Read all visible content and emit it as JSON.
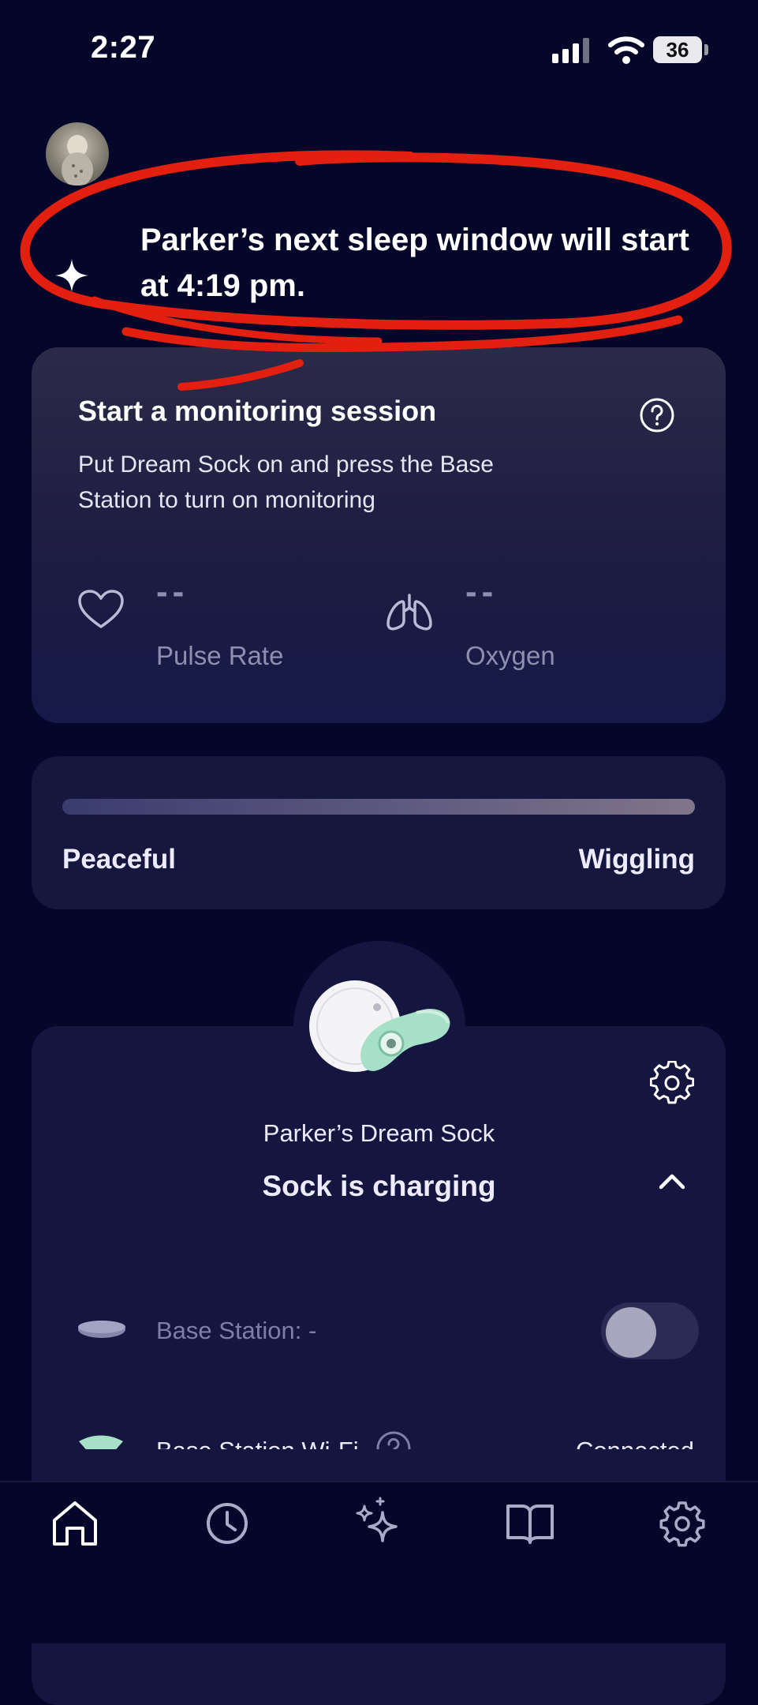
{
  "status_bar": {
    "time": "2:27",
    "battery": "36"
  },
  "banner": {
    "text": "Parker’s next sleep window will start at 4:19 pm."
  },
  "monitoring": {
    "title": "Start a monitoring session",
    "description": "Put Dream Sock on and press the Base Station to turn on monitoring",
    "pulse_value": "--",
    "pulse_label": "Pulse Rate",
    "oxygen_value": "--",
    "oxygen_label": "Oxygen"
  },
  "movement": {
    "left_label": "Peaceful",
    "right_label": "Wiggling"
  },
  "sock": {
    "name": "Parker’s Dream Sock",
    "status": "Sock is charging",
    "base_station_label": "Base Station: -",
    "base_station_on": false,
    "wifi_label": "Base Station Wi-Fi",
    "wifi_status": "Connected"
  },
  "tabs": [
    "home-icon",
    "history-icon",
    "sparkles-icon",
    "book-icon",
    "settings-icon"
  ],
  "colors": {
    "background": "#05072a",
    "card": "#14163f",
    "annotation": "#e3200f",
    "mint": "#a6e0c8"
  }
}
